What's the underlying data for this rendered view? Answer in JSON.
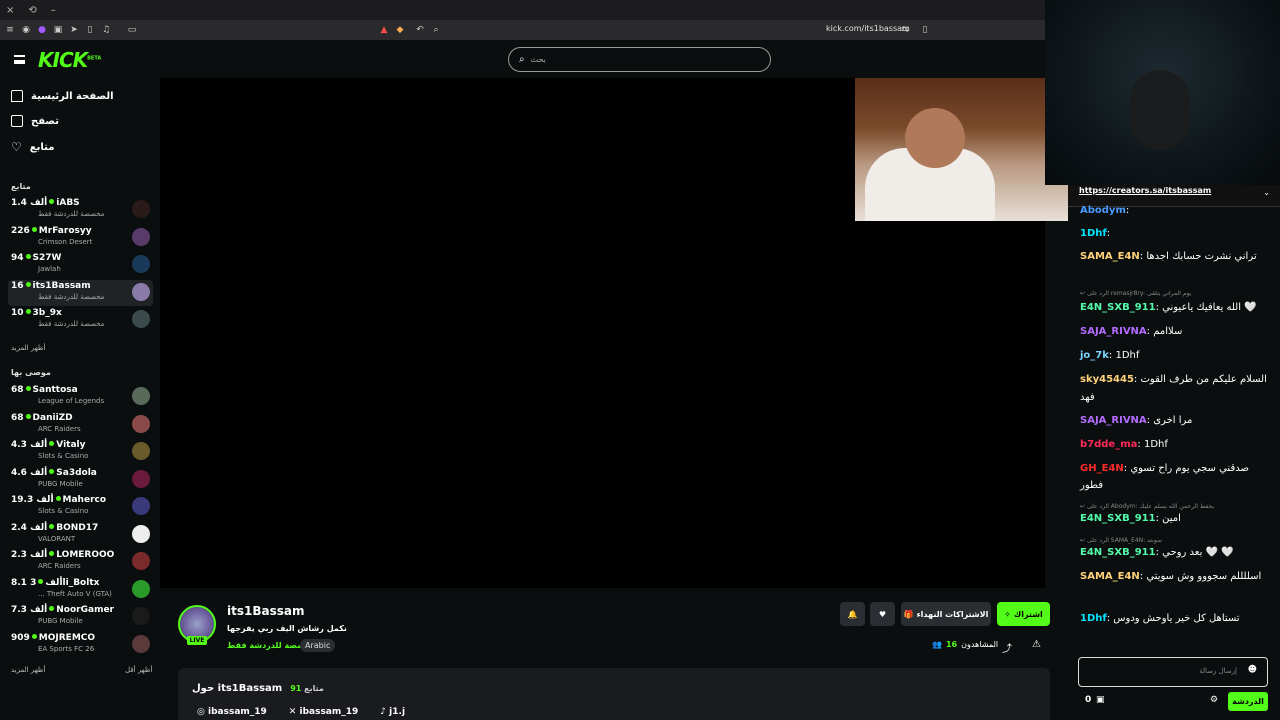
{
  "browser": {
    "url": "kick.com/its1bassam",
    "close": "×",
    "restore": "⟲",
    "minimize": "–"
  },
  "header": {
    "logo": "KICK",
    "logo_sup": "BETA",
    "search_placeholder": "بحث"
  },
  "sidebar": {
    "nav": [
      {
        "label": "الصفحة الرئيسية",
        "icon": "home-icon"
      },
      {
        "label": "تصفح",
        "icon": "browse-icon"
      },
      {
        "label": "متابع",
        "icon": "heart-icon"
      }
    ],
    "following_title": "متابع",
    "following": [
      {
        "count": "1.4 ألف",
        "name": "iABS",
        "sub": "مخصصة للدردشة فقط",
        "color": "#2a1a1a"
      },
      {
        "count": "226",
        "name": "MrFarosyy",
        "sub": "Crimson Desert",
        "color": "#5a3a6a"
      },
      {
        "count": "94",
        "name": "S27W",
        "sub": "Jawlah",
        "color": "#1a3a5a"
      },
      {
        "count": "16",
        "name": "its1Bassam",
        "sub": "مخصصة للدردشة فقط",
        "color": "#8a7aa8",
        "active": true
      },
      {
        "count": "10",
        "name": "3b_9x",
        "sub": "مخصصة للدردشة فقط",
        "color": "#3a4a4a"
      }
    ],
    "show_more": "أظهر المزيد",
    "recommended_title": "موصى بها",
    "recommended": [
      {
        "count": "68",
        "name": "Santtosa",
        "sub": "League of Legends",
        "color": "#5a6a5a"
      },
      {
        "count": "68",
        "name": "DaniiZD",
        "sub": "ARC Raiders",
        "color": "#8a4a4a"
      },
      {
        "count": "4.3 ألف",
        "name": "Vitaly",
        "sub": "Slots & Casino",
        "color": "#6a5a2a"
      },
      {
        "count": "4.6 ألف",
        "name": "Sa3dola",
        "sub": "PUBG Mobile",
        "color": "#6a1a3a"
      },
      {
        "count": "19.3 ألف",
        "name": "Maherco",
        "sub": "Slots & Casino",
        "color": "#3a3a7a"
      },
      {
        "count": "2.4 ألف",
        "name": "BOND17",
        "sub": "VALORANT",
        "color": "#eeeeee"
      },
      {
        "count": "2.3 ألف",
        "name": "LOMEROOO",
        "sub": "ARC Raiders",
        "color": "#7a2a2a"
      },
      {
        "count": "8.1 ألف",
        "name": "3li_Boltx",
        "sub": "... Theft Auto V (GTA)",
        "color": "#2a9a2a"
      },
      {
        "count": "7.3 ألف",
        "name": "NoorGamer",
        "sub": "PUBG Mobile",
        "color": "#1a1a1a"
      },
      {
        "count": "909",
        "name": "MOJREMCO",
        "sub": "EA Sports FC 26",
        "color": "#5a3a3a"
      }
    ],
    "show_less": "أظهر أقل",
    "show_more2": "أظهر المزيد"
  },
  "stream": {
    "streamer": "its1Bassam",
    "title": "نكمل رشاش اليف ربي يفرجها",
    "category": "مخصصة للدردشة فقط",
    "tag": "Arabic",
    "live": "LIVE",
    "viewers_label": "المشاهدون",
    "viewers": "16",
    "subscribe": "اشتراك",
    "gift_subs": "الاشتراكات النهداء",
    "about_title": "حول its1Bassam",
    "followers_count": "91",
    "followers_label": "متابع",
    "socials": [
      {
        "icon": "instagram-icon",
        "label": "ibassam_19"
      },
      {
        "icon": "x-icon",
        "label": "ibassam_19"
      },
      {
        "icon": "tiktok-icon",
        "label": "j1.j"
      }
    ]
  },
  "chat": {
    "pinned": "https://creators.sa/itsbassam",
    "messages": [
      {
        "user": "Abodym",
        "color": "#4a9aff",
        "text": ""
      },
      {
        "user": "1Dhf",
        "color": "#00e5ff",
        "text": ""
      },
      {
        "user": "SAMA_E4N",
        "color": "#ffd27a",
        "text": "تراني نشرت حسابك اجدها"
      },
      {
        "reply": "الرد على remasjr8ry: يوم المراني يتلقى"
      },
      {
        "user": "E4N_SXB_911",
        "color": "#53fcaa",
        "text": "الله يعافيك ياعيوني 🤍"
      },
      {
        "user": "SAJA_RIVNA",
        "color": "#b36bff",
        "text": "سلاامم"
      },
      {
        "user": "jo_7k",
        "color": "#7dd3ff",
        "text": "1Dhf"
      },
      {
        "user": "sky45445",
        "color": "#ffd27a",
        "text": "السلام عليكم من طرف القوت"
      },
      {
        "text2": "فهد"
      },
      {
        "user": "SAJA_RIVNA",
        "color": "#b36bff",
        "text": "مرا اخرى"
      },
      {
        "user": "b7dde_ma",
        "color": "#ff2a5a",
        "text": "1Dhf"
      },
      {
        "user": "GH_E4N",
        "color": "#ff2a2a",
        "text": "صدقني سجي يوم راح تسوي"
      },
      {
        "text2": "فطور"
      },
      {
        "reply": "الرد على Abodym: يحفظ الرحمن الله يسلم عليك"
      },
      {
        "user": "E4N_SXB_911",
        "color": "#53fcaa",
        "text": "امين"
      },
      {
        "reply": "الرد على SAMA_E4N: سونته"
      },
      {
        "user": "E4N_SXB_911",
        "color": "#53fcaa",
        "text": "بعد روحي 🤍 🤍"
      },
      {
        "user": "SAMA_E4N",
        "color": "#ffd27a",
        "text": "اسللللم سجووو وش سويتي"
      },
      {
        "user": "1Dhf",
        "color": "#00e5ff",
        "text": "تستاهل كل خير ياوحش ودوس"
      }
    ],
    "input_placeholder": "إرسال رسالة",
    "send": "الدردشة",
    "points": "0"
  }
}
